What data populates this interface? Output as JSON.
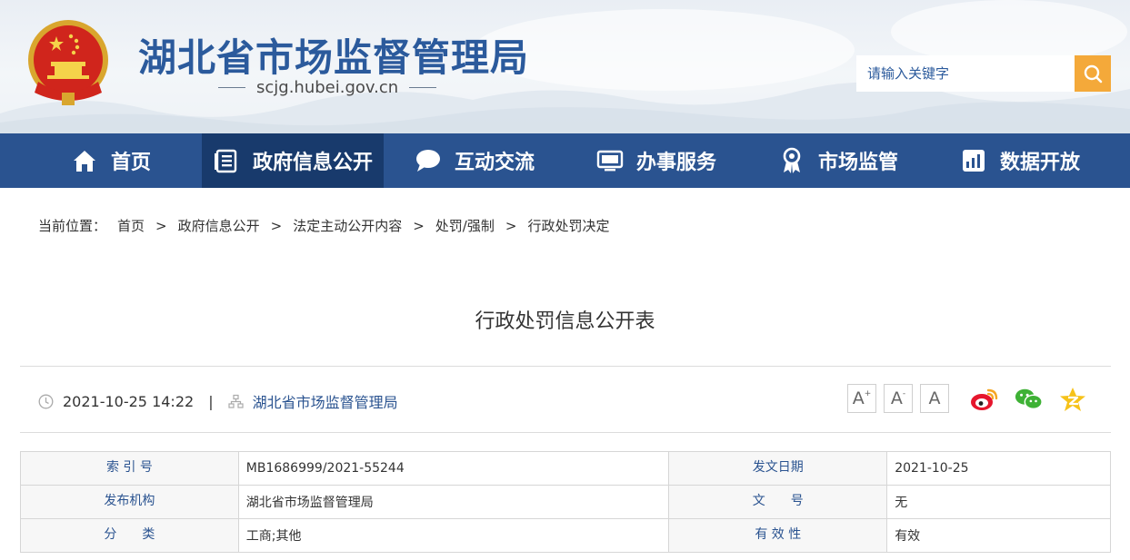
{
  "header": {
    "site_title": "湖北省市场监督管理局",
    "site_url": "scjg.hubei.gov.cn",
    "search_placeholder": "请输入关键字"
  },
  "nav": {
    "items": [
      {
        "label": "首页",
        "icon": "home-icon"
      },
      {
        "label": "政府信息公开",
        "icon": "document-list-icon",
        "active": true
      },
      {
        "label": "互动交流",
        "icon": "chat-bubble-icon"
      },
      {
        "label": "办事服务",
        "icon": "monitor-icon"
      },
      {
        "label": "市场监管",
        "icon": "award-badge-icon"
      },
      {
        "label": "数据开放",
        "icon": "chart-icon"
      }
    ]
  },
  "breadcrumb": {
    "label": "当前位置：",
    "items": [
      "首页",
      "政府信息公开",
      "法定主动公开内容",
      "处罚/强制",
      "行政处罚决定"
    ],
    "separator": ">"
  },
  "document": {
    "title": "行政处罚信息公开表",
    "date": "2021-10-25 14:22",
    "divider": "|",
    "publisher": "湖北省市场监督管理局"
  },
  "font_controls": {
    "large": "A",
    "large_mark": "+",
    "small": "A",
    "small_mark": "-",
    "reset": "A"
  },
  "share": [
    "weibo-icon",
    "wechat-icon",
    "qzone-icon"
  ],
  "info_table": {
    "rows": [
      {
        "k1": "索 引 号",
        "v1": "MB1686999/2021-55244",
        "k2": "发文日期",
        "v2": "2021-10-25"
      },
      {
        "k1": "发布机构",
        "v1": "湖北省市场监督管理局",
        "k2": "文　　号",
        "v2": "无"
      },
      {
        "k1": "分　　类",
        "v1": "工商;其他",
        "k2": "有 效 性",
        "v2": "有效"
      }
    ]
  },
  "colors": {
    "nav_bg": "#2a5390",
    "nav_active": "#183a6c",
    "title_blue": "#2b5a9c",
    "search_btn": "#f4a93a"
  }
}
